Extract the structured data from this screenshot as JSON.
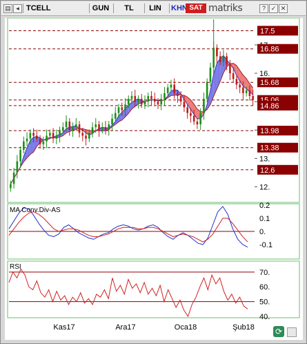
{
  "toolbar": {
    "symbol": "TCELL",
    "period": "GUN",
    "currency": "TL",
    "scale": "LIN",
    "khn": "KHN",
    "signal": "SAT",
    "brand": "matriks",
    "win_buttons": [
      "?",
      "✓",
      "✕"
    ]
  },
  "panels": {
    "ma_title": "MA Conv.Div-AS",
    "rsi_title": "RSI"
  },
  "colors": {
    "up": "#1a8f1a",
    "down": "#c01b1b",
    "label_bg": "#8b0000",
    "band_up": "#7b7bea",
    "band_down": "#ee7c7c",
    "macd": "#2030c8",
    "signal_line": "#d02020",
    "rsi_line": "#d02020",
    "ref_line": "#8b0000"
  },
  "chart_data": [
    {
      "type": "candlestick",
      "title": "TCELL",
      "x_labels": [
        "Kas17",
        "Ara17",
        "Oca18",
        "Şub18"
      ],
      "ylim": [
        11.5,
        17.9
      ],
      "price_ticks": [
        17.0,
        16.0,
        15.0,
        14.0,
        13.0,
        12.0
      ],
      "price_tick_labels": [
        "17.",
        "16.",
        "15.",
        "14.",
        "13.",
        "12."
      ],
      "levels": [
        17.5,
        16.86,
        15.68,
        15.06,
        14.86,
        13.98,
        13.38,
        12.6
      ],
      "level_labels": [
        "17.5",
        "16.86",
        "15.68",
        "15.06",
        "14.86",
        "13.98",
        "13.38",
        "12.6"
      ],
      "close": [
        12.1,
        12.5,
        12.9,
        13.3,
        13.6,
        13.7,
        13.9,
        13.8,
        13.7,
        13.5,
        13.6,
        13.8,
        13.9,
        13.7,
        13.8,
        14.0,
        14.1,
        14.3,
        14.0,
        14.1,
        14.2,
        13.9,
        13.8,
        13.7,
        13.9,
        14.1,
        14.2,
        14.0,
        14.1,
        14.0,
        14.2,
        14.4,
        14.6,
        14.8,
        14.7,
        14.9,
        15.1,
        15.2,
        15.0,
        15.1,
        14.9,
        15.0,
        15.2,
        15.1,
        15.0,
        14.9,
        15.1,
        15.3,
        15.5,
        15.6,
        15.3,
        15.2,
        15.0,
        14.8,
        14.6,
        14.5,
        14.3,
        14.2,
        14.6,
        15.1,
        15.7,
        16.2,
        16.9,
        16.6,
        16.4,
        16.6,
        16.3,
        16.0,
        15.8,
        15.6,
        15.5,
        15.3,
        15.4,
        15.2,
        15.06
      ],
      "macd_ylim": [
        -0.2,
        0.2
      ],
      "macd_ticks": [
        0.2,
        0.1,
        0.0,
        -0.1
      ],
      "macd_tick_labels": [
        "0.2",
        "0.1",
        "0.",
        "-0.1"
      ],
      "macd": [
        0.02,
        0.08,
        0.14,
        0.18,
        0.17,
        0.12,
        0.06,
        0.01,
        -0.03,
        -0.04,
        -0.02,
        0.03,
        0.05,
        0.02,
        -0.01,
        -0.03,
        -0.05,
        -0.06,
        -0.04,
        -0.02,
        -0.01,
        0.02,
        0.04,
        0.05,
        0.04,
        0.02,
        0.01,
        0.02,
        0.04,
        0.05,
        0.03,
        -0.01,
        -0.04,
        -0.06,
        -0.03,
        -0.01,
        -0.03,
        -0.06,
        -0.09,
        -0.1,
        -0.05,
        0.05,
        0.15,
        0.19,
        0.13,
        0.02,
        -0.06,
        -0.1,
        -0.12
      ],
      "signal": [
        -0.03,
        0.02,
        0.07,
        0.11,
        0.14,
        0.15,
        0.13,
        0.1,
        0.06,
        0.02,
        0.0,
        0.01,
        0.02,
        0.02,
        0.01,
        -0.01,
        -0.03,
        -0.04,
        -0.04,
        -0.03,
        -0.02,
        0.0,
        0.02,
        0.03,
        0.03,
        0.03,
        0.02,
        0.02,
        0.03,
        0.03,
        0.02,
        0.0,
        -0.02,
        -0.04,
        -0.03,
        -0.02,
        -0.03,
        -0.04,
        -0.06,
        -0.08,
        -0.06,
        -0.02,
        0.04,
        0.1,
        0.1,
        0.06,
        0.01,
        -0.04,
        -0.08
      ],
      "rsi_ylim": [
        40,
        76
      ],
      "rsi_ticks": [
        70,
        60,
        50,
        40
      ],
      "rsi_tick_labels": [
        "70.",
        "60.",
        "50.",
        "40."
      ],
      "rsi_levels": [
        70,
        50
      ],
      "rsi": [
        63,
        70,
        66,
        72,
        68,
        60,
        58,
        64,
        56,
        53,
        58,
        50,
        57,
        51,
        54,
        48,
        53,
        50,
        56,
        49,
        52,
        48,
        55,
        53,
        58,
        52,
        66,
        57,
        61,
        55,
        65,
        59,
        62,
        56,
        63,
        55,
        59,
        54,
        61,
        50,
        58,
        52,
        46,
        51,
        44,
        40,
        48,
        53,
        60,
        66,
        58,
        68,
        62,
        66,
        57,
        51,
        55,
        49,
        53,
        47,
        45
      ]
    }
  ]
}
